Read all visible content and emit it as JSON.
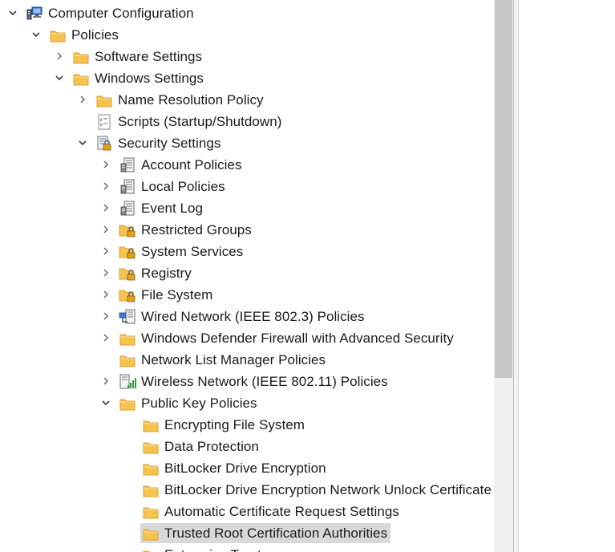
{
  "tree": {
    "rows": [
      {
        "label": "Computer Configuration",
        "depth": 0,
        "expander": "expanded",
        "icon": "computer-icon"
      },
      {
        "label": "Policies",
        "depth": 1,
        "expander": "expanded",
        "icon": "folder-icon"
      },
      {
        "label": "Software Settings",
        "depth": 2,
        "expander": "collapsed",
        "icon": "folder-icon"
      },
      {
        "label": "Windows Settings",
        "depth": 2,
        "expander": "expanded",
        "icon": "folder-icon"
      },
      {
        "label": "Name Resolution Policy",
        "depth": 3,
        "expander": "collapsed",
        "icon": "folder-icon"
      },
      {
        "label": "Scripts (Startup/Shutdown)",
        "depth": 3,
        "expander": "none",
        "icon": "script-icon"
      },
      {
        "label": "Security Settings",
        "depth": 3,
        "expander": "expanded",
        "icon": "security-settings-icon"
      },
      {
        "label": "Account Policies",
        "depth": 4,
        "expander": "collapsed",
        "icon": "policy-document-icon"
      },
      {
        "label": "Local Policies",
        "depth": 4,
        "expander": "collapsed",
        "icon": "policy-document-icon"
      },
      {
        "label": "Event Log",
        "depth": 4,
        "expander": "collapsed",
        "icon": "policy-document-icon"
      },
      {
        "label": "Restricted Groups",
        "depth": 4,
        "expander": "collapsed",
        "icon": "locked-folder-icon"
      },
      {
        "label": "System Services",
        "depth": 4,
        "expander": "collapsed",
        "icon": "locked-folder-icon"
      },
      {
        "label": "Registry",
        "depth": 4,
        "expander": "collapsed",
        "icon": "locked-folder-icon"
      },
      {
        "label": "File System",
        "depth": 4,
        "expander": "collapsed",
        "icon": "locked-folder-icon"
      },
      {
        "label": "Wired Network (IEEE 802.3) Policies",
        "depth": 4,
        "expander": "collapsed",
        "icon": "wired-network-icon"
      },
      {
        "label": "Windows Defender Firewall with Advanced Security",
        "depth": 4,
        "expander": "collapsed",
        "icon": "folder-icon"
      },
      {
        "label": "Network List Manager Policies",
        "depth": 4,
        "expander": "none",
        "icon": "folder-icon"
      },
      {
        "label": "Wireless Network (IEEE 802.11) Policies",
        "depth": 4,
        "expander": "collapsed",
        "icon": "wireless-network-icon"
      },
      {
        "label": "Public Key Policies",
        "depth": 4,
        "expander": "expanded",
        "icon": "folder-icon"
      },
      {
        "label": "Encrypting File System",
        "depth": 5,
        "expander": "none",
        "icon": "folder-icon"
      },
      {
        "label": "Data Protection",
        "depth": 5,
        "expander": "none",
        "icon": "folder-icon"
      },
      {
        "label": "BitLocker Drive Encryption",
        "depth": 5,
        "expander": "none",
        "icon": "folder-icon"
      },
      {
        "label": "BitLocker Drive Encryption Network Unlock Certificate",
        "depth": 5,
        "expander": "none",
        "icon": "folder-icon"
      },
      {
        "label": "Automatic Certificate Request Settings",
        "depth": 5,
        "expander": "none",
        "icon": "folder-icon"
      },
      {
        "label": "Trusted Root Certification Authorities",
        "depth": 5,
        "expander": "none",
        "icon": "folder-icon",
        "selected": true
      },
      {
        "label": "Enterprise Trust",
        "depth": 5,
        "expander": "none",
        "icon": "folder-icon"
      }
    ]
  },
  "colors": {
    "folder": "#f6c34f",
    "folder_dark": "#d9a233",
    "selection": "#d9d9d9",
    "lock": "#e0a31c"
  }
}
